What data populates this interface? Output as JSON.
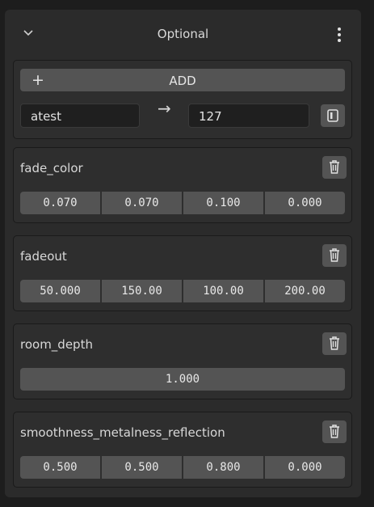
{
  "panel": {
    "title": "Optional",
    "collapse_icon": "chevron-down-icon",
    "menu_icon": "kebab-menu-icon"
  },
  "add_row": {
    "plus": "+",
    "label": "ADD",
    "name_value": "atest",
    "arrow": "→",
    "value_value": "127",
    "type_icon": "property-type-icon"
  },
  "properties": [
    {
      "name": "fade_color",
      "values": [
        "0.070",
        "0.070",
        "0.100",
        "0.000"
      ],
      "delete_icon": "trash-icon"
    },
    {
      "name": "fadeout",
      "values": [
        "50.000",
        "150.00",
        "100.00",
        "200.00"
      ],
      "delete_icon": "trash-icon"
    },
    {
      "name": "room_depth",
      "values": [
        "1.000"
      ],
      "delete_icon": "trash-icon"
    },
    {
      "name": "smoothness_metalness_reflection",
      "values": [
        "0.500",
        "0.500",
        "0.800",
        "0.000"
      ],
      "delete_icon": "trash-icon"
    }
  ],
  "colors": {
    "background": "#1d1d1d",
    "panel": "#2b2b2b",
    "button": "#545454",
    "field": "#1f1f1f"
  }
}
